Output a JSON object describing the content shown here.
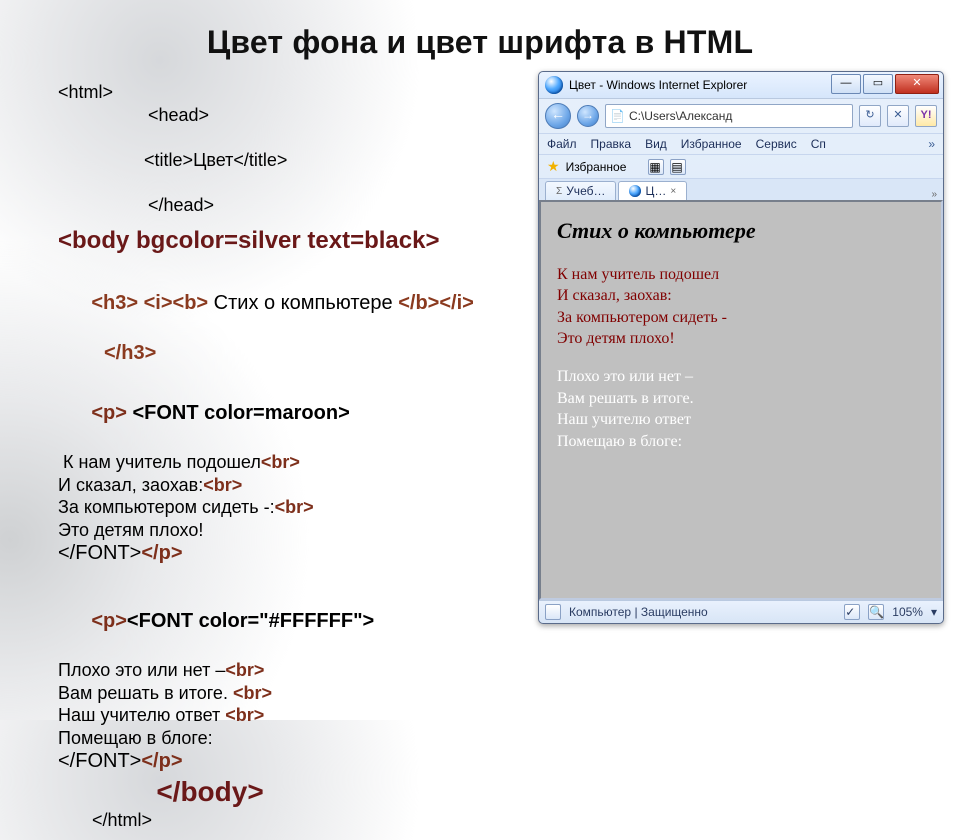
{
  "title": "Цвет фона и цвет шрифта в HTML",
  "code": {
    "html_open": "<html>",
    "head_open": "<head>",
    "title_open": "<title>",
    "title_text": "Цвет",
    "title_close": "</title>",
    "head_close": "</head>",
    "body_tag": "<body bgcolor=silver text=black>",
    "h3_open": "<h3>",
    "ib_open": "<i><b>",
    "h3_text": " Стих о компьютере ",
    "ib_close": "</b></i>",
    "h3_close": "</h3>",
    "p_open": "<p>",
    "font_maroon": " <FONT color=maroon>",
    "poem1_l1": " К нам учитель подошел",
    "poem1_l2": "И сказал, заохав:",
    "poem1_l3": "За компьютером сидеть -:",
    "poem1_l4": "Это детям плохо!",
    "br": "<br>",
    "font_close": "</FONT>",
    "p_close": "</p>",
    "font_white": "<FONT color=\"#FFFFFF\">",
    "poem2_l1": "Плохо это или нет –",
    "poem2_l2": "Вам решать в итоге. ",
    "poem2_l3": "Наш учителю ответ ",
    "poem2_l4": "Помещаю в блоге:",
    "body_close": "</body>",
    "html_close": "</html>"
  },
  "ie": {
    "window_title": "Цвет - Windows Internet Explorer",
    "win_min": "—",
    "win_max": "▭",
    "win_close": "✕",
    "nav_back": "←",
    "nav_fwd": "→",
    "address": "C:\\Users\\Александ",
    "addr_refresh": "↻",
    "addr_stop": "✕",
    "search_y": "Y!",
    "menu": [
      "Файл",
      "Правка",
      "Вид",
      "Избранное",
      "Сервис",
      "Сп"
    ],
    "menu_more": "»",
    "favorites_label": "Избранное",
    "fav_extra1": "▦",
    "fav_extra2": "▤",
    "tab1": "Учеб…",
    "tab2": "Ц…",
    "tab_close": "×",
    "content_heading": "Стих о компьютере",
    "p1": [
      "К нам учитель подошел",
      "И сказал, заохав:",
      "За компьютером сидеть -",
      "Это детям плохо!"
    ],
    "p2": [
      "Плохо это или нет –",
      "Вам решать в итоге.",
      "Наш учителю ответ",
      "Помещаю в блоге:"
    ],
    "status_text": "Компьютер | Защищенно",
    "status_mode": "✓",
    "zoom": "105%",
    "zoom_dd": "▾"
  }
}
